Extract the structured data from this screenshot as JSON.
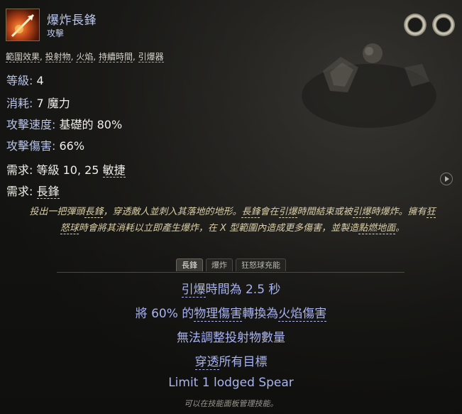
{
  "skill": {
    "name": "爆炸長鋒",
    "category": "攻擊"
  },
  "tags": [
    "範圍效果",
    "投射物",
    "火焰",
    "持續時間",
    "引爆器"
  ],
  "stats": {
    "level_label": "等級:",
    "level_value": "4",
    "cost_label": "消耗:",
    "cost_value": "7 魔力",
    "speed_label": "攻擊速度:",
    "speed_value": "基礎的 80%",
    "damage_label": "攻擊傷害:",
    "damage_value": "66%",
    "req_label": "需求:",
    "req_prefix": "等級 10, 25 ",
    "req_attr": "敏捷",
    "req2_label": "需求:",
    "req2_value": "長鋒"
  },
  "description": {
    "p1": "投出一把彈頭",
    "k1": "長鋒",
    "p2": "，穿透敵人並刺入其落地的地形。",
    "k2": "長鋒",
    "p3": "會在",
    "k3": "引爆",
    "p4": "時間結束或被",
    "k4": "引爆",
    "p5": "時爆炸。擁有",
    "k5": "狂怒球",
    "p6": "時會將其消耗以立即產生爆炸，在 X 型範圍內造成更多傷害，並製造",
    "k6": "點燃地面",
    "p7": "。"
  },
  "tabs": [
    "長鋒",
    "爆炸",
    "狂怒球充能"
  ],
  "modifiers": {
    "m1_k": "引爆",
    "m1_rest": "時間為 2.5 秒",
    "m2_a": "將 60% 的",
    "m2_k": "物理傷害",
    "m2_b": "轉換為",
    "m2_k2": "火焰傷害",
    "m3": "無法調整投射物數量",
    "m4_k": "穿透",
    "m4_rest": "所有目標",
    "m5": "Limit 1 lodged Spear"
  },
  "footer": "可以在技能面板管理技能。",
  "colors": {
    "accent_blue": "#a9b3f2",
    "description_gold": "#d9cfa6",
    "stat_label": "#b8c4ea"
  },
  "icons": [
    "fire-spear-skill-icon",
    "socket-ring-icon",
    "play-icon"
  ]
}
